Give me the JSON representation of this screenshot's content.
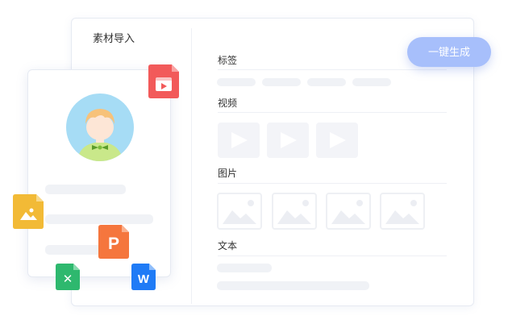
{
  "panel": {
    "title": "素材导入"
  },
  "sections": {
    "tags": {
      "label": "标签"
    },
    "video": {
      "label": "视频"
    },
    "image": {
      "label": "图片"
    },
    "text": {
      "label": "文本"
    }
  },
  "actions": {
    "generate_label": "一键生成"
  },
  "file_icons": {
    "ppt": {
      "glyph": "P",
      "color": "#f5763d"
    },
    "excel": {
      "glyph": "✕",
      "color": "#2eb86e"
    },
    "word": {
      "glyph": "W",
      "color": "#1f7bf6"
    },
    "image": {
      "color": "#f2ba36"
    },
    "video": {
      "color": "#f25a5a"
    }
  },
  "colors": {
    "accent": "#a7bffb",
    "skeleton": "#f0f2f6"
  }
}
